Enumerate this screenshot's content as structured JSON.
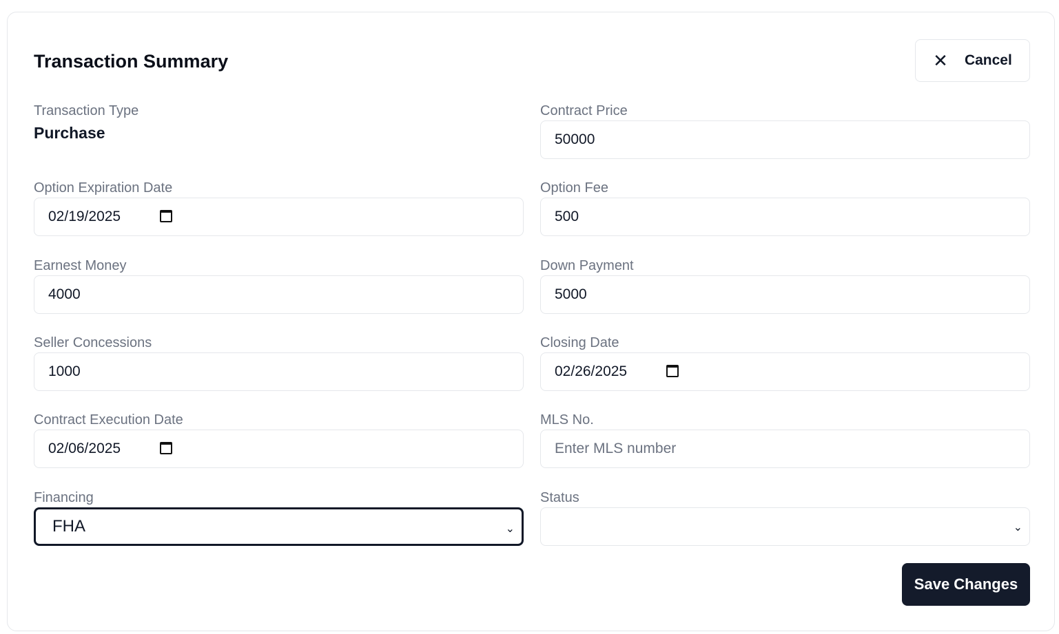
{
  "header": {
    "title": "Transaction Summary",
    "cancel_label": "Cancel"
  },
  "fields": {
    "transaction_type": {
      "label": "Transaction Type",
      "value": "Purchase"
    },
    "contract_price": {
      "label": "Contract Price",
      "value": "50000"
    },
    "option_expiration_date": {
      "label": "Option Expiration Date",
      "value": "02/19/2025"
    },
    "option_fee": {
      "label": "Option Fee",
      "value": "500"
    },
    "earnest_money": {
      "label": "Earnest Money",
      "value": "4000"
    },
    "down_payment": {
      "label": "Down Payment",
      "value": "5000"
    },
    "seller_concessions": {
      "label": "Seller Concessions",
      "value": "1000"
    },
    "closing_date": {
      "label": "Closing Date",
      "value": "02/26/2025"
    },
    "contract_execution_date": {
      "label": "Contract Execution Date",
      "value": "02/06/2025"
    },
    "mls_no": {
      "label": "MLS No.",
      "value": "",
      "placeholder": "Enter MLS number"
    },
    "financing": {
      "label": "Financing",
      "value": "FHA"
    },
    "status": {
      "label": "Status",
      "value": ""
    }
  },
  "footer": {
    "save_label": "Save Changes"
  },
  "colors": {
    "primary_button": "#141b2b",
    "label": "#6b7280",
    "border": "#e5e7eb"
  }
}
